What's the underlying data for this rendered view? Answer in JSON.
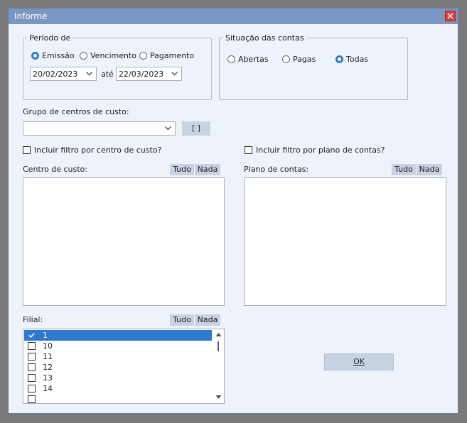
{
  "window": {
    "title": "Informe"
  },
  "periodo": {
    "legend": "Período de",
    "options": [
      "Emissão",
      "Vencimento",
      "Pagamento"
    ],
    "selected": "Emissão",
    "date_from": "20/02/2023",
    "ate_label": "até",
    "date_to": "22/03/2023"
  },
  "situacao": {
    "legend": "Situação das contas",
    "options": [
      "Abertas",
      "Pagas",
      "Todas"
    ],
    "selected": "Todas"
  },
  "grupo": {
    "label": "Grupo de centros de custo:",
    "value": "",
    "button_label": "[    ]"
  },
  "filtro_centro": {
    "label": "Incluir filtro por centro de custo?",
    "checked": false
  },
  "filtro_plano": {
    "label": "Incluir filtro por plano de contas?",
    "checked": false
  },
  "centro_custo": {
    "label": "Centro de custo:",
    "tudo": "Tudo",
    "nada": "Nada"
  },
  "plano_contas": {
    "label": "Plano de contas:",
    "tudo": "Tudo",
    "nada": "Nada"
  },
  "filial": {
    "label": "Filial:",
    "tudo": "Tudo",
    "nada": "Nada",
    "items": [
      {
        "label": "1",
        "checked": true
      },
      {
        "label": "10",
        "checked": false
      },
      {
        "label": "11",
        "checked": false
      },
      {
        "label": "12",
        "checked": false
      },
      {
        "label": "13",
        "checked": false
      },
      {
        "label": "14",
        "checked": false
      }
    ]
  },
  "ok_label": "OK",
  "colors": {
    "accent": "#2e7ad1",
    "titlebar": "#7a97c2",
    "close": "#e23c3c"
  }
}
